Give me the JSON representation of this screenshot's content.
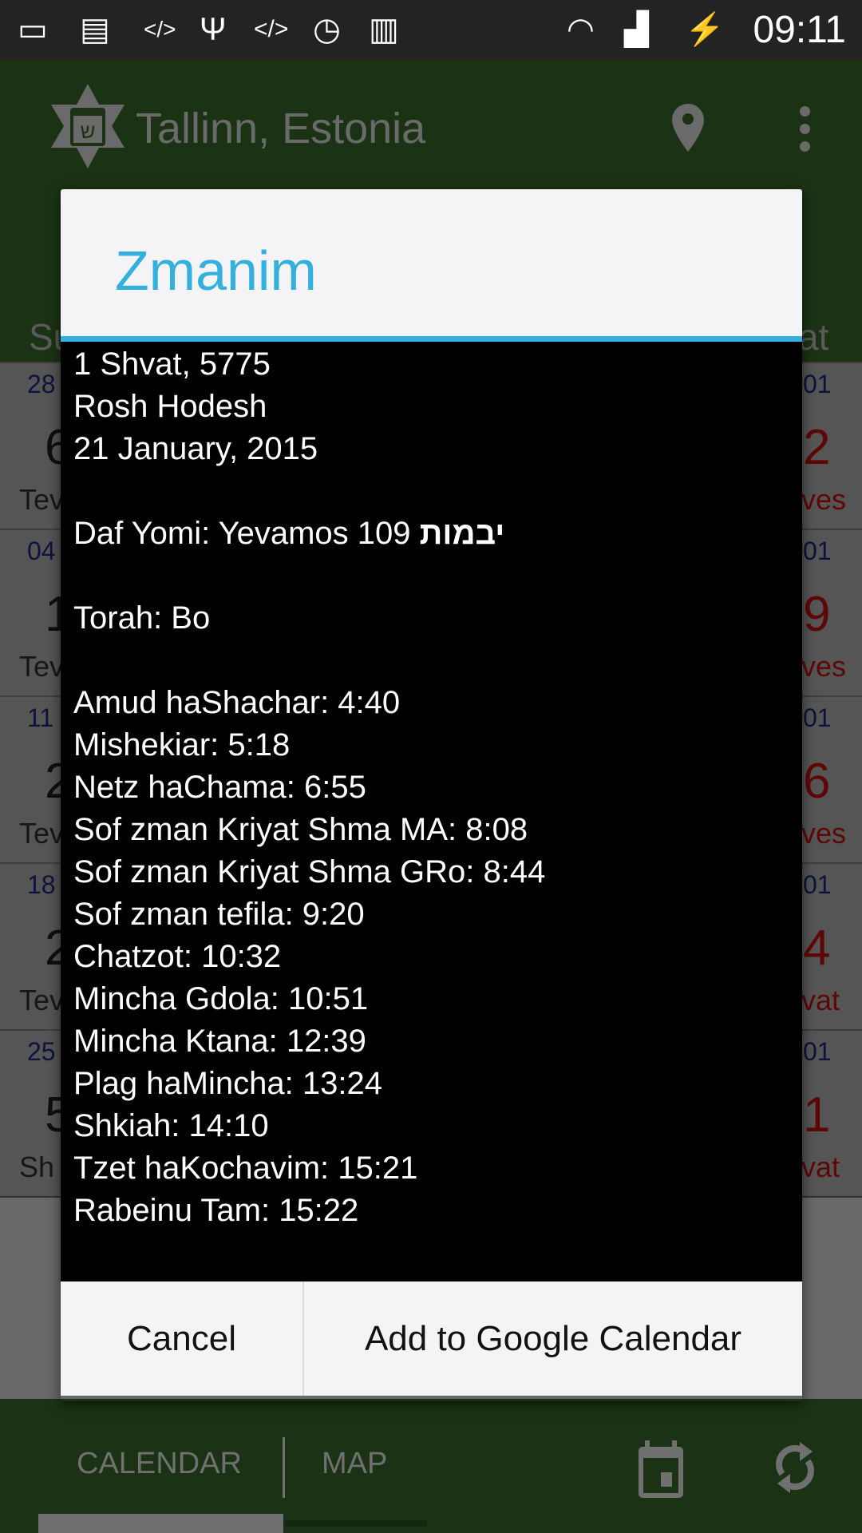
{
  "status_bar": {
    "icons": [
      "battery-saver-icon",
      "image-icon",
      "code-icon",
      "usb-icon",
      "code-icon",
      "alarm-icon",
      "barcode-icon",
      "wifi-icon",
      "signal-icon",
      "battery-charging-icon"
    ],
    "time": "09:11"
  },
  "header": {
    "title": "Tallinn, Estonia",
    "logo_letter": "ש"
  },
  "calendar": {
    "weekday_left": "Su",
    "weekday_right": "at",
    "rows": [
      {
        "left": {
          "greg": "28",
          "heb": "6",
          "label": "Tev"
        },
        "right": {
          "greg": "01",
          "heb": "2",
          "label": "ves"
        }
      },
      {
        "left": {
          "greg": "04",
          "heb": "1",
          "label": "Tev"
        },
        "right": {
          "greg": "01",
          "heb": "9",
          "label": "ves"
        }
      },
      {
        "left": {
          "greg": "11",
          "heb": "2",
          "label": "Tev"
        },
        "right": {
          "greg": "01",
          "heb": "6",
          "label": "ves"
        }
      },
      {
        "left": {
          "greg": "18",
          "heb": "2",
          "label": "Tev"
        },
        "right": {
          "greg": "01",
          "heb": "4",
          "label": "vat"
        }
      },
      {
        "left": {
          "greg": "25",
          "heb": "5",
          "label": "Sh"
        },
        "right": {
          "greg": "01",
          "heb": "1",
          "label": "vat"
        }
      }
    ]
  },
  "bottom_bar": {
    "tabs": [
      "CALENDAR",
      "MAP"
    ],
    "active_tab": "CALENDAR"
  },
  "dialog": {
    "title": "Zmanim",
    "hebrew_date": "1 Shvat, 5775",
    "holiday": "Rosh Hodesh",
    "gregorian_date": "21 January, 2015",
    "daf_yomi": "Daf Yomi: Yevamos 109",
    "daf_yomi_hebrew": "יבמות",
    "torah": "Torah: Bo",
    "zmanim": [
      "Amud haShachar: 4:40",
      "Mishekiar: 5:18",
      "Netz haChama: 6:55",
      "Sof zman Kriyat Shma MA: 8:08",
      "Sof zman Kriyat Shma GRo: 8:44",
      "Sof zman tefila: 9:20",
      "Chatzot: 10:32",
      "Mincha Gdola: 10:51",
      "Mincha Ktana: 12:39",
      "Plag haMincha: 13:24",
      "Shkiah: 14:10",
      "Tzet haKochavim: 15:21",
      "Rabeinu Tam: 15:22"
    ],
    "cancel_label": "Cancel",
    "add_label": "Add to Google Calendar"
  },
  "colors": {
    "accent": "#33b0dd",
    "app_green": "#3a7a23",
    "weekend_red": "#d01010"
  }
}
